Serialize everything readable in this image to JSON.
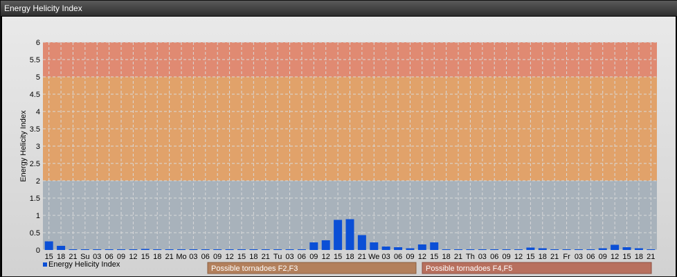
{
  "window": {
    "title": "Energy Helicity Index"
  },
  "colors": {
    "band_low": "#a8b2bb",
    "band_mid": "#e1a26a",
    "band_high": "#e08a72",
    "bar": "#0b4fd6",
    "grid": "#d9d9d9",
    "panel_f2f3": "#b3805c",
    "panel_f4f5": "#b8705e"
  },
  "chart_data": {
    "type": "bar",
    "title": "Energy Helicity Index",
    "ylabel": "Energy Helicity Index",
    "xlabel": "",
    "ylim": [
      0,
      6
    ],
    "yticks": [
      "0",
      "0.5",
      "1",
      "1.5",
      "2",
      "2.5",
      "3",
      "3.5",
      "4",
      "4.5",
      "5",
      "5.5",
      "6"
    ],
    "bands": [
      {
        "from": 0,
        "to": 2,
        "color": "#a8b2bb"
      },
      {
        "from": 2,
        "to": 5,
        "color": "#e1a26a"
      },
      {
        "from": 5,
        "to": 6,
        "color": "#e08a72"
      }
    ],
    "categories": [
      "15",
      "18",
      "21",
      "Su",
      "03",
      "06",
      "09",
      "12",
      "15",
      "18",
      "21",
      "Mo",
      "03",
      "06",
      "09",
      "12",
      "15",
      "18",
      "21",
      "Tu",
      "03",
      "06",
      "09",
      "12",
      "15",
      "18",
      "21",
      "We",
      "03",
      "06",
      "09",
      "12",
      "15",
      "18",
      "21",
      "Th",
      "03",
      "06",
      "09",
      "12",
      "15",
      "18",
      "21",
      "Fr",
      "03",
      "06",
      "09",
      "12",
      "15",
      "18",
      "21"
    ],
    "series": [
      {
        "name": "Energy Helicity Index",
        "values": [
          0.25,
          0.12,
          0.02,
          0.02,
          0.02,
          0.02,
          0.02,
          0.02,
          0.03,
          0.02,
          0.02,
          0.02,
          0.02,
          0.02,
          0.02,
          0.02,
          0.02,
          0.02,
          0.02,
          0.02,
          0.02,
          0.02,
          0.22,
          0.28,
          0.87,
          0.89,
          0.43,
          0.22,
          0.1,
          0.08,
          0.05,
          0.16,
          0.22,
          0.02,
          0.02,
          0.02,
          0.02,
          0.02,
          0.02,
          0.02,
          0.07,
          0.05,
          0.02,
          0.02,
          0.02,
          0.02,
          0.05,
          0.15,
          0.08,
          0.05,
          0.02
        ]
      }
    ],
    "legend": {
      "label": "Energy Helicity Index",
      "position": "bottom-left"
    },
    "annotations": [
      "Possible tornadoes F2,F3",
      "Possible tornadoes F4,F5"
    ],
    "grid": true
  }
}
